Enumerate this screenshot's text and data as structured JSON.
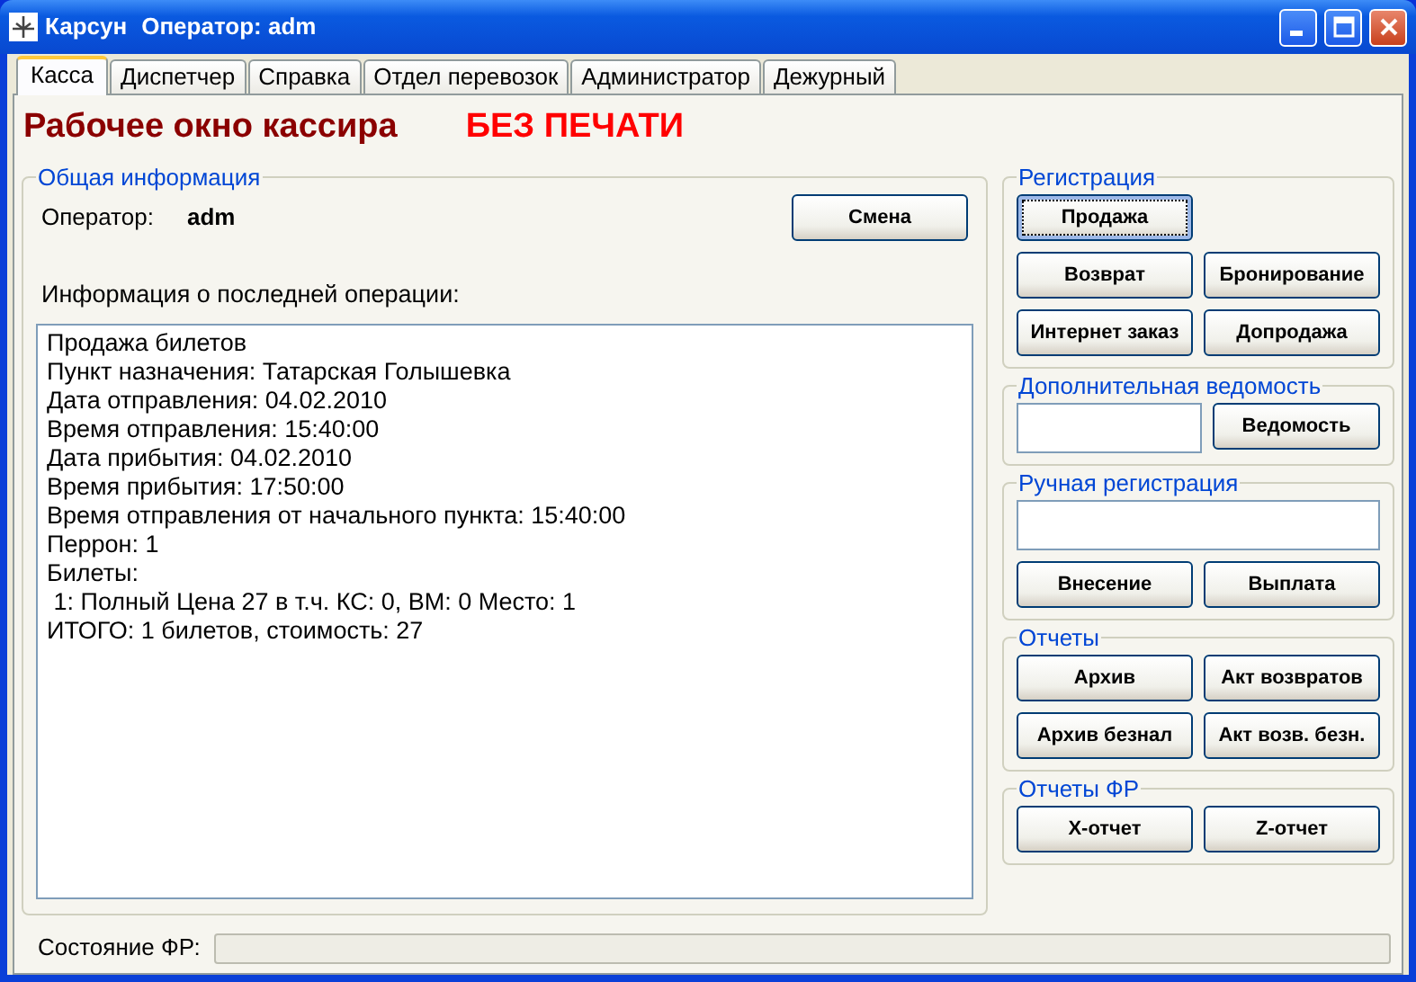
{
  "window": {
    "app_name": "Карсун",
    "title": "Оператор: adm"
  },
  "tabs": [
    {
      "label": "Касса",
      "selected": true
    },
    {
      "label": "Диспетчер",
      "selected": false
    },
    {
      "label": "Справка",
      "selected": false
    },
    {
      "label": "Отдел перевозок",
      "selected": false
    },
    {
      "label": "Администратор",
      "selected": false
    },
    {
      "label": "Дежурный",
      "selected": false
    }
  ],
  "heading": {
    "title": "Рабочее окно кассира",
    "mode": "БЕЗ ПЕЧАТИ"
  },
  "general": {
    "legend": "Общая информация",
    "operator_label": "Оператор:",
    "operator": "adm",
    "button": "Смена",
    "info_label": "Информация о последней операции:",
    "info_lines": [
      "Продажа билетов",
      "Пункт назначения: Татарская Голышевка",
      "Дата отправления: 04.02.2010",
      "Время отправления: 15:40:00",
      "Дата прибытия: 04.02.2010",
      "Время прибытия: 17:50:00",
      "Время отправления от начального пункта: 15:40:00",
      "Перрон: 1",
      "Билеты:",
      " 1: Полный Цена 27 в т.ч. КС: 0, ВМ: 0 Место: 1",
      "ИТОГО: 1 билетов, стоимость: 27"
    ]
  },
  "groups": [
    {
      "legend": "Регистрация",
      "rows": [
        [
          {
            "kind": "button",
            "label": "Продажа",
            "focused": true
          }
        ],
        [
          {
            "kind": "button",
            "label": "Возврат",
            "focused": false
          },
          {
            "kind": "button",
            "label": "Бронирование",
            "focused": false
          }
        ],
        [
          {
            "kind": "button",
            "label": "Интернет заказ",
            "focused": false
          },
          {
            "kind": "button",
            "label": "Допродажа",
            "focused": false
          }
        ]
      ]
    },
    {
      "legend": "Дополнительная ведомость",
      "rows": [
        [
          {
            "kind": "field"
          },
          {
            "kind": "button",
            "label": "Ведомость",
            "focused": false
          }
        ]
      ]
    },
    {
      "legend": "Ручная регистрация",
      "rows": [
        [
          {
            "kind": "wide_field"
          }
        ],
        [
          {
            "kind": "button",
            "label": "Внесение",
            "focused": false
          },
          {
            "kind": "button",
            "label": "Выплата",
            "focused": false
          }
        ]
      ]
    },
    {
      "legend": "Отчеты",
      "rows": [
        [
          {
            "kind": "button",
            "label": "Архив",
            "focused": false
          },
          {
            "kind": "button",
            "label": "Акт возвратов",
            "focused": false
          }
        ],
        [
          {
            "kind": "button",
            "label": "Архив безнал",
            "focused": false
          },
          {
            "kind": "button",
            "label": "Акт возв. безн.",
            "focused": false
          }
        ]
      ]
    },
    {
      "legend": "Отчеты ФР",
      "rows": [
        [
          {
            "kind": "button",
            "label": "X-отчет",
            "focused": false
          },
          {
            "kind": "button",
            "label": "Z-отчет",
            "focused": false
          }
        ]
      ]
    }
  ],
  "status_bar": {
    "label": "Состояние ФР:",
    "level": 0
  }
}
